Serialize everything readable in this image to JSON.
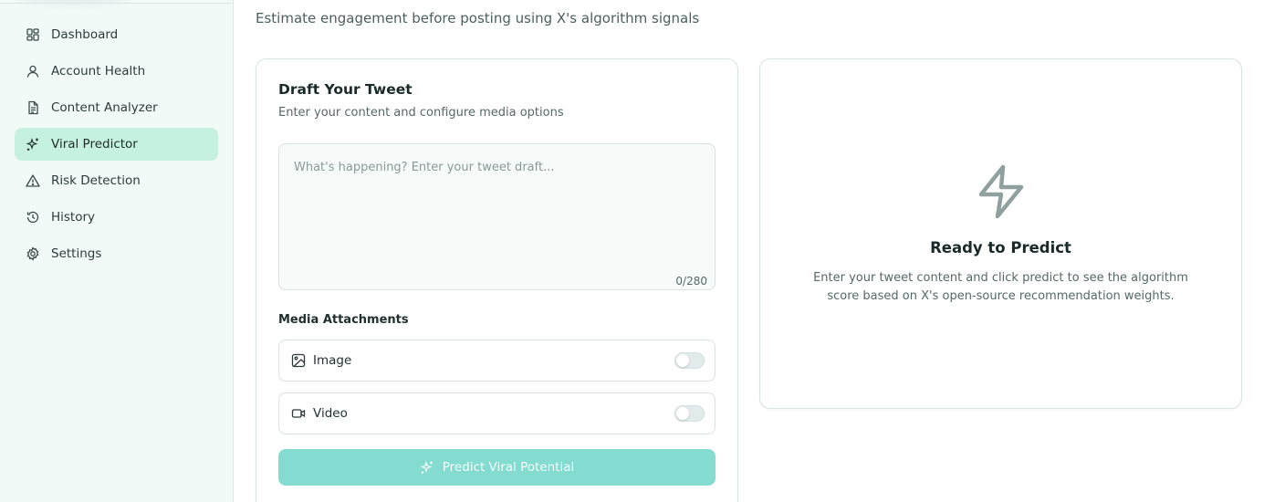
{
  "sidebar": {
    "items": [
      {
        "label": "Dashboard",
        "icon": "grid-icon",
        "active": false
      },
      {
        "label": "Account Health",
        "icon": "user-icon",
        "active": false
      },
      {
        "label": "Content Analyzer",
        "icon": "document-icon",
        "active": false
      },
      {
        "label": "Viral Predictor",
        "icon": "sparkles-icon",
        "active": true
      },
      {
        "label": "Risk Detection",
        "icon": "warning-icon",
        "active": false
      },
      {
        "label": "History",
        "icon": "history-icon",
        "active": false
      },
      {
        "label": "Settings",
        "icon": "gear-icon",
        "active": false
      }
    ]
  },
  "header": {
    "subtitle": "Estimate engagement before posting using X's algorithm signals"
  },
  "draft": {
    "title": "Draft Your Tweet",
    "description": "Enter your content and configure media options",
    "placeholder": "What's happening? Enter your tweet draft...",
    "value": "",
    "char_count": "0/280",
    "media_label": "Media Attachments",
    "media": [
      {
        "label": "Image",
        "icon": "image-icon",
        "enabled": false
      },
      {
        "label": "Video",
        "icon": "video-icon",
        "enabled": false
      }
    ],
    "predict_label": "Predict Viral Potential"
  },
  "result": {
    "title": "Ready to Predict",
    "description": "Enter your tweet content and click predict to see the algorithm score based on X's open-source recommendation weights."
  },
  "colors": {
    "sidebar_bg": "#f2faf8",
    "active_item_bg": "#c6f0df",
    "predict_button_bg": "#84dbd0",
    "icon_muted": "#8fa09e"
  }
}
